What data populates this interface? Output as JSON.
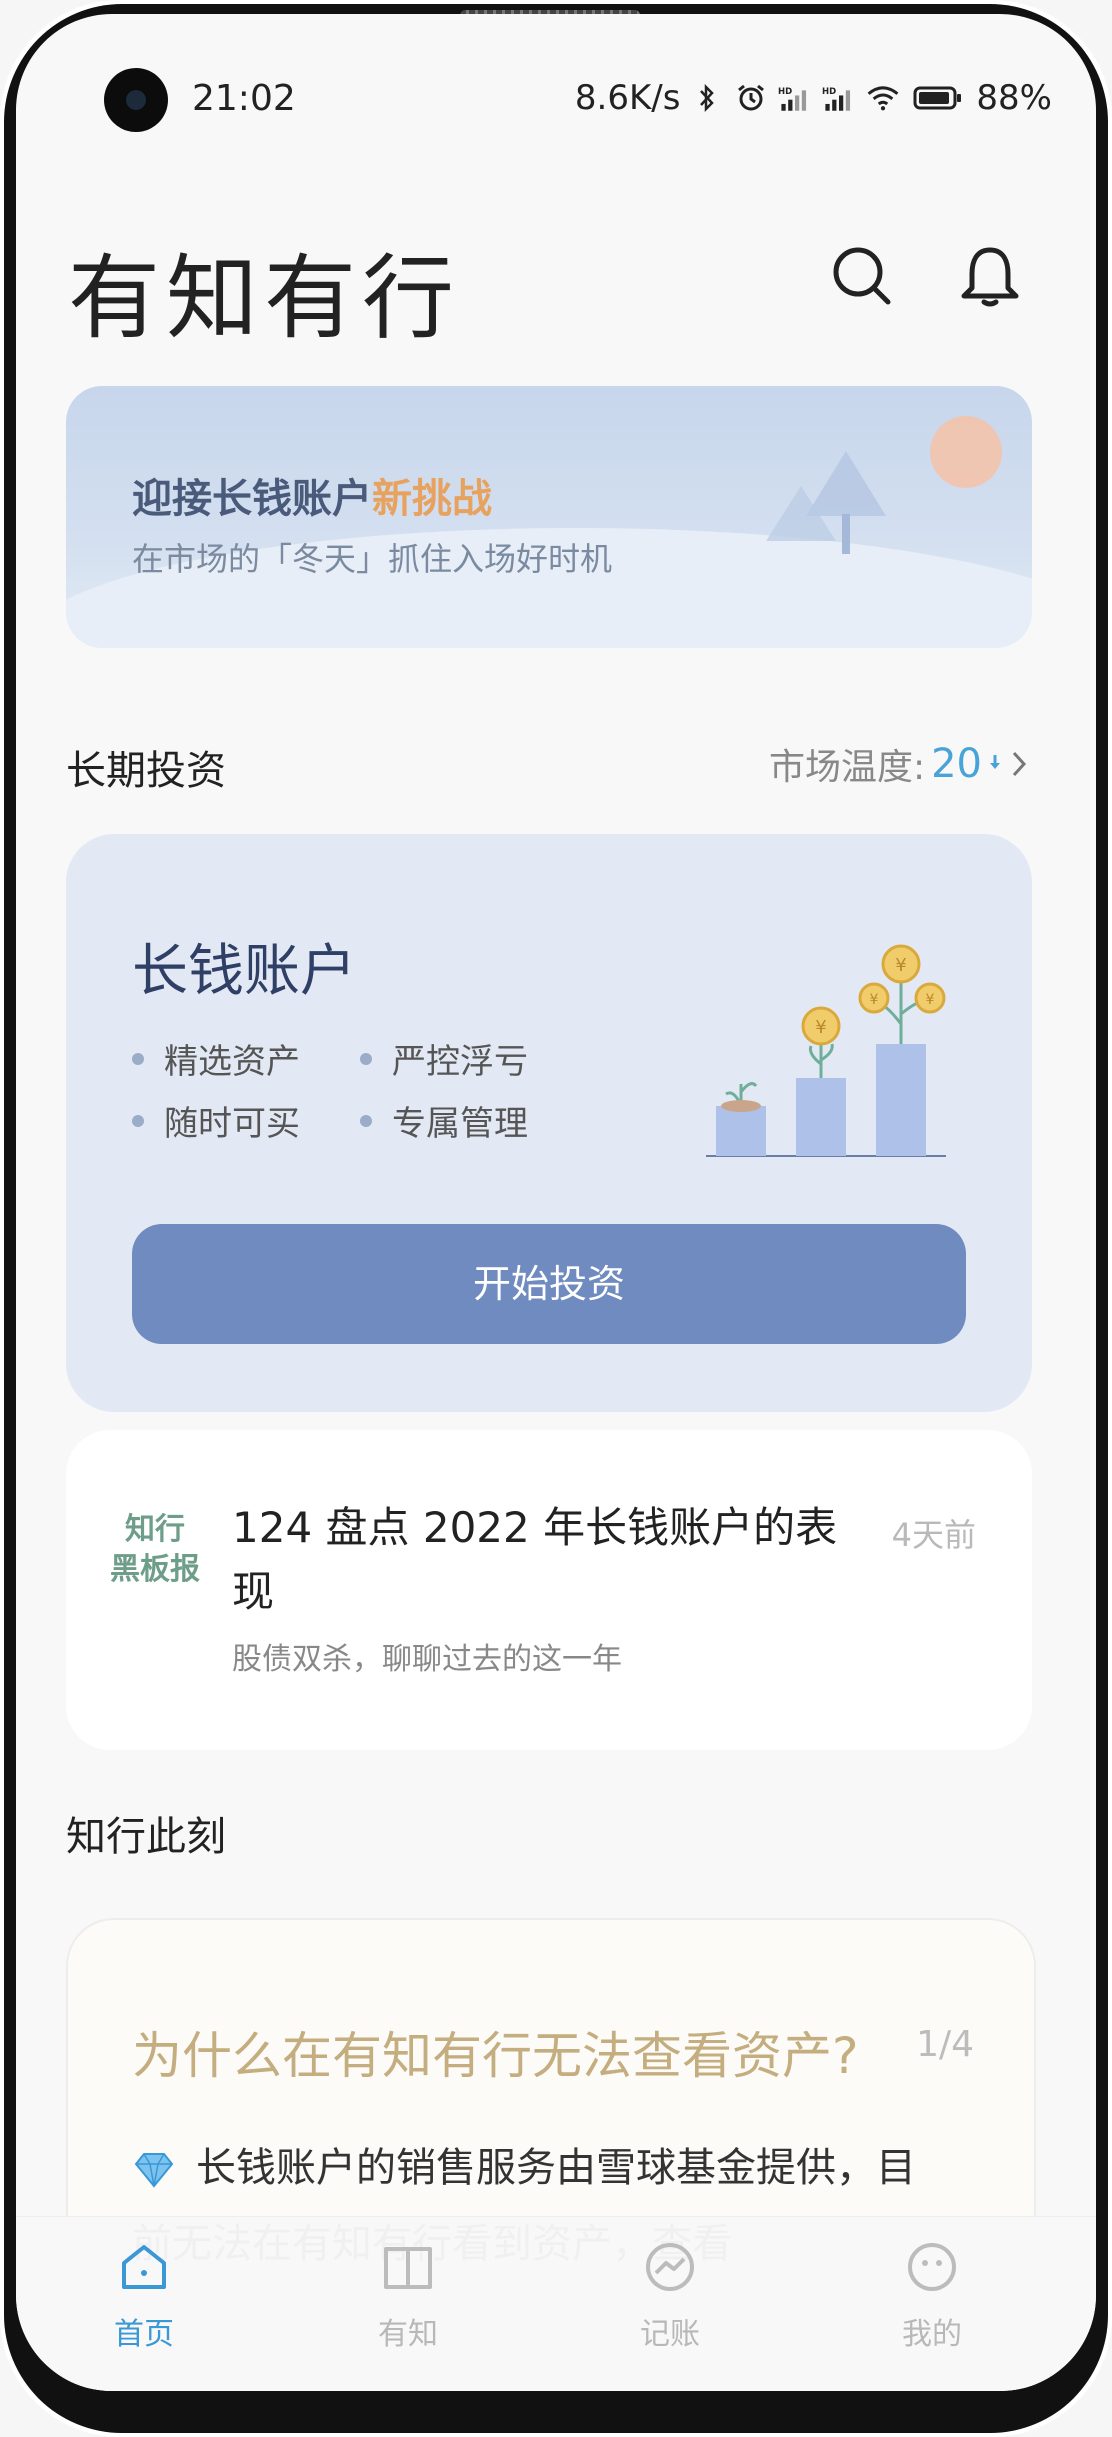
{
  "status": {
    "time": "21:02",
    "speed": "8.6K/s",
    "battery": "88%",
    "signal_labels": [
      "HD",
      "HD"
    ]
  },
  "header": {
    "title": "有知有行",
    "search_icon": "search-icon",
    "bell_icon": "bell-icon"
  },
  "banner": {
    "title_main": "迎接长钱账户",
    "title_accent": "新挑战",
    "subtitle": "在市场的「冬天」抓住入场好时机",
    "accent_color": "#e8a25f"
  },
  "long_term": {
    "section_title": "长期投资",
    "temp_label": "市场温度:",
    "temp_value": "20",
    "account": {
      "title": "长钱账户",
      "features": [
        "精选资产",
        "严控浮亏",
        "随时可买",
        "专属管理"
      ],
      "button": "开始投资"
    }
  },
  "article": {
    "tag_line1": "知行",
    "tag_line2": "黑板报",
    "title": "124 盘点 2022 年长钱账户的表现",
    "subtitle": "股债双杀，聊聊过去的这一年",
    "time": "4天前"
  },
  "moment": {
    "section_title": "知行此刻",
    "question": "为什么在有知有行无法查看资产?",
    "page": "1/4",
    "text": "长钱账户的销售服务由雪球基金提供，目前无法在有知有行看到资产，查看"
  },
  "tabbar": {
    "items": [
      {
        "label": "首页",
        "icon": "home-icon"
      },
      {
        "label": "有知",
        "icon": "book-icon"
      },
      {
        "label": "记账",
        "icon": "chart-icon"
      },
      {
        "label": "我的",
        "icon": "face-icon"
      }
    ],
    "active_color": "#3a98d6"
  }
}
